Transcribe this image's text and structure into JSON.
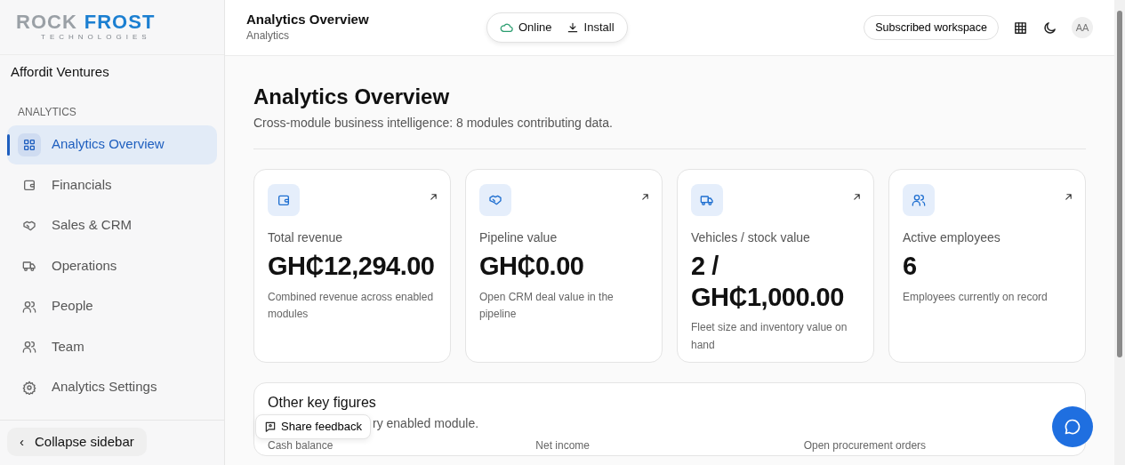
{
  "logo": {
    "word_1": "ROCK",
    "word_2": "FROST",
    "tagline": "TECHNOLOGIES"
  },
  "sidebar": {
    "org": "Affordit Ventures",
    "section": "ANALYTICS",
    "items": [
      {
        "label": "Analytics Overview",
        "selected": true
      },
      {
        "label": "Financials",
        "selected": false
      },
      {
        "label": "Sales & CRM",
        "selected": false
      },
      {
        "label": "Operations",
        "selected": false
      },
      {
        "label": "People",
        "selected": false
      },
      {
        "label": "Team",
        "selected": false
      },
      {
        "label": "Analytics Settings",
        "selected": false
      }
    ],
    "collapse": {
      "icon": "‹",
      "label": "Collapse sidebar"
    }
  },
  "header": {
    "title": "Analytics Overview",
    "subtitle": "Analytics",
    "status": "Online",
    "install": "Install",
    "workspace": "Subscribed workspace",
    "avatar": "AA"
  },
  "page": {
    "title": "Analytics Overview",
    "subtitle": "Cross-module business intelligence: 8 modules contributing data."
  },
  "cards": [
    {
      "label": "Total revenue",
      "value": "GH₵12,294.00",
      "note": "Combined revenue across enabled modules"
    },
    {
      "label": "Pipeline value",
      "value": "GH₵0.00",
      "note": "Open CRM deal value in the pipeline"
    },
    {
      "label": "Vehicles / stock value",
      "value": "2 / GH₵1,000.00",
      "note": "Fleet size and inventory value on hand"
    },
    {
      "label": "Active employees",
      "value": "6",
      "note": "Employees currently on record"
    }
  ],
  "key_figures": {
    "title": "Other key figures",
    "subtitle": "ry enabled module.",
    "columns": [
      "Cash balance",
      "Net income",
      "Open procurement orders"
    ]
  },
  "feedback": {
    "label": "Share feedback"
  }
}
